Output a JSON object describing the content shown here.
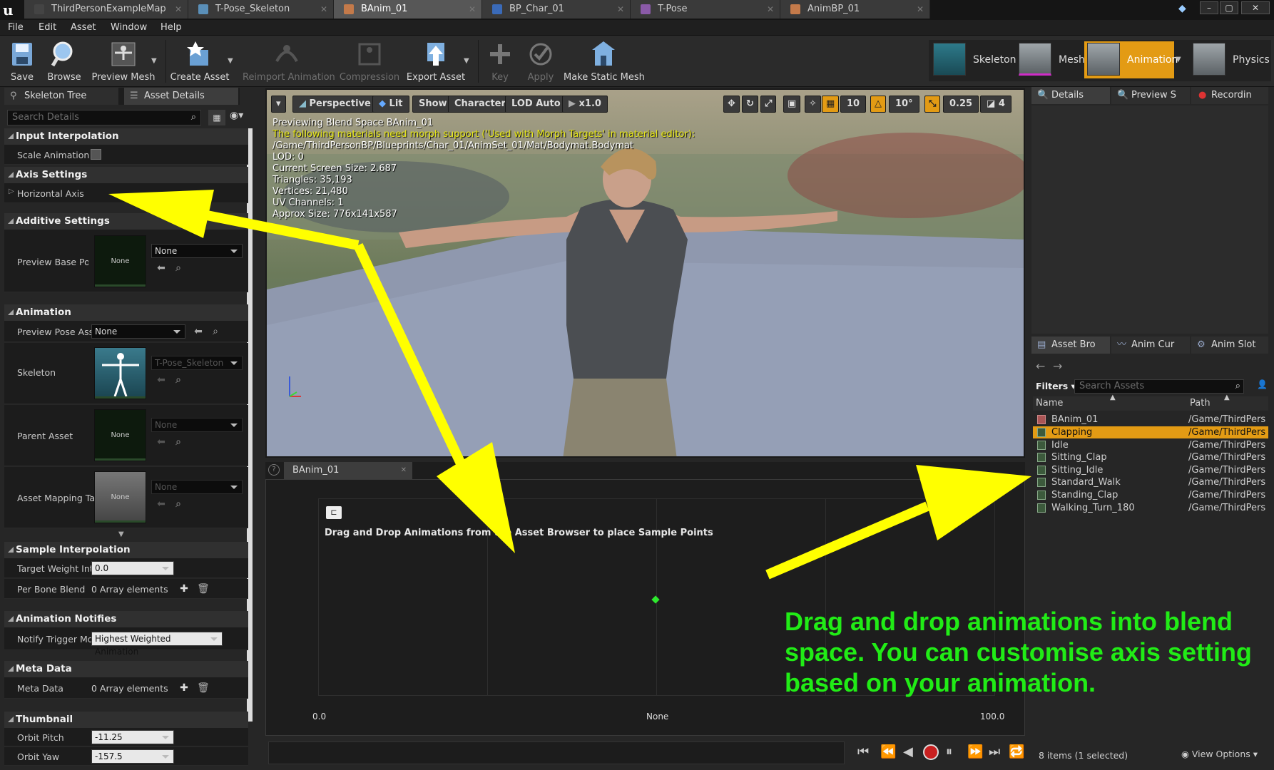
{
  "tabs": [
    {
      "label": "ThirdPersonExampleMap",
      "icon": "ue-logo-icon",
      "color": "#3a3a3a"
    },
    {
      "label": "T-Pose_Skeleton",
      "icon": "skeleton-icon",
      "color": "#5a8fb8"
    },
    {
      "label": "BAnim_01",
      "icon": "blendspace-icon",
      "color": "#c47a4a"
    },
    {
      "label": "BP_Char_01",
      "icon": "blueprint-icon",
      "color": "#3a6ab8"
    },
    {
      "label": "T-Pose",
      "icon": "animation-icon",
      "color": "#8a5aa8"
    },
    {
      "label": "AnimBP_01",
      "icon": "animbp-icon",
      "color": "#c47a4a"
    }
  ],
  "menu": [
    "File",
    "Edit",
    "Asset",
    "Window",
    "Help"
  ],
  "toolbar": {
    "save": "Save",
    "browse": "Browse",
    "preview_mesh": "Preview Mesh",
    "create_asset": "Create Asset",
    "reimport": "Reimport Animation",
    "compression": "Compression",
    "export": "Export Asset",
    "key": "Key",
    "apply": "Apply",
    "make_static": "Make Static Mesh"
  },
  "modes": {
    "skeleton": "Skeleton",
    "mesh": "Mesh",
    "animation": "Animation",
    "physics": "Physics"
  },
  "left": {
    "tab_skeleton_tree": "Skeleton Tree",
    "tab_asset_details": "Asset Details",
    "search_placeholder": "Search Details",
    "input_interp": {
      "title": "Input Interpolation",
      "scale_anim": "Scale Animation"
    },
    "axis": {
      "title": "Axis Settings",
      "horizontal": "Horizontal Axis"
    },
    "additive": {
      "title": "Additive Settings",
      "preview_base": "Preview Base Pos",
      "thumb": "None",
      "value": "None"
    },
    "animation": {
      "title": "Animation",
      "preview_pose": "Preview Pose Ass",
      "preview_pose_value": "None",
      "skeleton": "Skeleton",
      "skeleton_value": "T-Pose_Skeleton",
      "parent_asset": "Parent Asset",
      "parent_thumb": "None",
      "parent_value": "None",
      "mapping": "Asset Mapping Ta",
      "mapping_thumb": "None",
      "mapping_value": "None"
    },
    "sample_interp": {
      "title": "Sample Interpolation",
      "target_weight": "Target Weight Inte",
      "target_weight_value": "0.0",
      "per_bone": "Per Bone Blend",
      "per_bone_value": "0 Array elements"
    },
    "notifies": {
      "title": "Animation Notifies",
      "notify_trigger": "Notify Trigger Mo",
      "notify_value": "Highest Weighted Animation"
    },
    "meta": {
      "title": "Meta Data",
      "label": "Meta Data",
      "value": "0 Array elements"
    },
    "thumbnail": {
      "title": "Thumbnail",
      "orbit_pitch": "Orbit Pitch",
      "orbit_pitch_value": "-11.25",
      "orbit_yaw": "Orbit Yaw",
      "orbit_yaw_value": "-157.5"
    }
  },
  "viewport": {
    "perspective": "Perspective",
    "lit": "Lit",
    "show": "Show",
    "character": "Character",
    "lod": "LOD Auto",
    "speed": "x1.0",
    "grid_snap": "10",
    "rot_snap": "10°",
    "scale_snap": "0.25",
    "cam_speed": "4",
    "info": [
      {
        "text": "Previewing Blend Space BAnim_01",
        "color": "#ffffff"
      },
      {
        "text": "The following materials need morph support ('Used with Morph Targets' in material editor):",
        "color": "#e8e81a"
      },
      {
        "text": "/Game/ThirdPersonBP/Blueprints/Char_01/AnimSet_01/Mat/Bodymat.Bodymat",
        "color": "#ffffff"
      },
      {
        "text": "LOD: 0",
        "color": "#ffffff"
      },
      {
        "text": "Current Screen Size: 2.687",
        "color": "#ffffff"
      },
      {
        "text": "Triangles: 35,193",
        "color": "#ffffff"
      },
      {
        "text": "Vertices: 21,480",
        "color": "#ffffff"
      },
      {
        "text": "UV Channels: 1",
        "color": "#ffffff"
      },
      {
        "text": "Approx Size: 776x141x587",
        "color": "#ffffff"
      }
    ]
  },
  "blendspace": {
    "tab": "BAnim_01",
    "hint": "Drag and Drop Animations from the Asset Browser to place Sample Points",
    "x_min": "0.0",
    "x_mid": "None",
    "x_max": "100.0"
  },
  "right": {
    "tab_details": "Details",
    "tab_preview": "Preview S",
    "tab_recording": "Recordin",
    "tab_asset_browser": "Asset Bro",
    "tab_anim_curves": "Anim Cur",
    "tab_anim_slots": "Anim Slot",
    "filters": "Filters",
    "search_placeholder": "Search Assets",
    "col_name": "Name",
    "col_path": "Path",
    "assets": [
      {
        "name": "BAnim_01",
        "path": "/Game/ThirdPers",
        "selected": false
      },
      {
        "name": "Clapping",
        "path": "/Game/ThirdPers",
        "selected": true
      },
      {
        "name": "Idle",
        "path": "/Game/ThirdPers",
        "selected": false
      },
      {
        "name": "Sitting_Clap",
        "path": "/Game/ThirdPers",
        "selected": false
      },
      {
        "name": "Sitting_Idle",
        "path": "/Game/ThirdPers",
        "selected": false
      },
      {
        "name": "Standard_Walk",
        "path": "/Game/ThirdPers",
        "selected": false
      },
      {
        "name": "Standing_Clap",
        "path": "/Game/ThirdPers",
        "selected": false
      },
      {
        "name": "Walking_Turn_180",
        "path": "/Game/ThirdPers",
        "selected": false
      }
    ],
    "item_count": "8 items (1 selected)",
    "view_options": "View Options"
  },
  "annotation": "Drag and drop animations into blend space. You can customise axis setting based on your animation.",
  "colors": {
    "accent": "#e39b14",
    "annotation": "#21ec16",
    "arrow": "#ffff00"
  }
}
